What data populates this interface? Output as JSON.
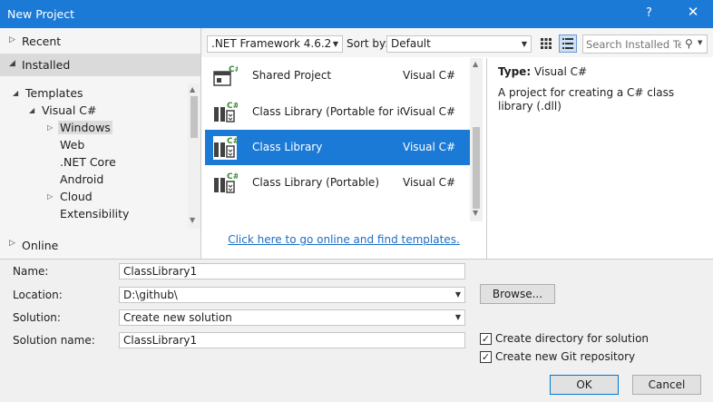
{
  "window": {
    "title": "New Project",
    "help_glyph": "?",
    "close_glyph": "✕"
  },
  "left_pane": {
    "recent_label": "Recent",
    "installed_label": "Installed",
    "online_label": "Online",
    "tree": [
      {
        "label": "Templates",
        "expanded": true
      },
      {
        "label": "Visual C#",
        "expanded": true
      },
      {
        "label": "Windows",
        "selected": true
      },
      {
        "label": "Web"
      },
      {
        "label": ".NET Core"
      },
      {
        "label": "Android"
      },
      {
        "label": "Cloud"
      },
      {
        "label": "Extensibility"
      }
    ]
  },
  "toolbar": {
    "framework_value": ".NET Framework 4.6.2",
    "sort_by_label": "Sort by:",
    "sort_value": "Default",
    "search_placeholder": "Search Installed Templates (Ctrl+E)"
  },
  "templates": [
    {
      "name": "Shared Project",
      "language": "Visual C#",
      "icon": "shared-project-icon"
    },
    {
      "name": "Class Library (Portable for iOS, Android and Windows)",
      "language": "Visual C#",
      "icon": "class-library-icon"
    },
    {
      "name": "Class Library",
      "language": "Visual C#",
      "icon": "class-library-icon",
      "selected": true
    },
    {
      "name": "Class Library (Portable)",
      "language": "Visual C#",
      "icon": "class-library-icon"
    }
  ],
  "online_link_text": "Click here to go online and find templates.",
  "info": {
    "type_label": "Type:",
    "type_value": "Visual C#",
    "description": "A project for creating a C# class library (.dll)"
  },
  "form": {
    "name_label": "Name:",
    "name_value": "ClassLibrary1",
    "location_label": "Location:",
    "location_value": "D:\\github\\",
    "solution_label": "Solution:",
    "solution_value": "Create new solution",
    "solution_name_label": "Solution name:",
    "solution_name_value": "ClassLibrary1",
    "browse_label": "Browse...",
    "create_directory_label": "Create directory for solution",
    "create_directory_checked": true,
    "create_git_label": "Create new Git repository",
    "create_git_checked": true,
    "ok_label": "OK",
    "cancel_label": "Cancel"
  },
  "colors": {
    "accent": "#1b7ad6",
    "link": "#1c6dc6",
    "csharp_green": "#388a34"
  }
}
